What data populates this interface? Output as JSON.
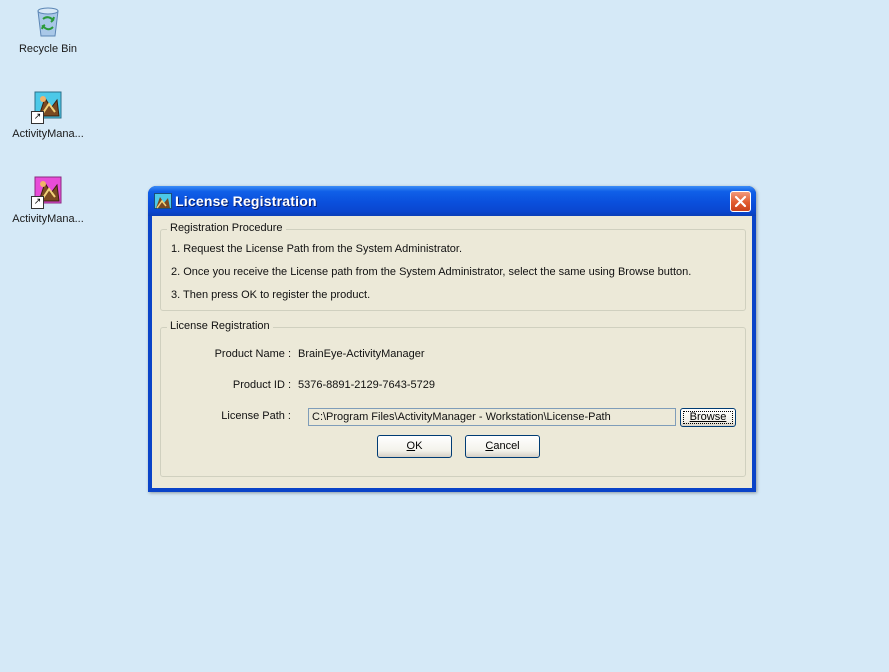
{
  "desktop": {
    "icons": [
      {
        "label": "Recycle Bin",
        "icon": "recycle-bin-icon"
      },
      {
        "label": "ActivityMana...",
        "icon": "activity-manager-shortcut-icon"
      },
      {
        "label": "ActivityMana...",
        "icon": "activity-manager-shortcut-icon"
      }
    ]
  },
  "dialog": {
    "title": "License Registration",
    "procedure": {
      "legend": "Registration Procedure",
      "steps": [
        "1. Request the License Path from the System Administrator.",
        "2. Once you receive the License path from the System Administrator, select the same using Browse button.",
        "3. Then press OK to register the product."
      ]
    },
    "registration": {
      "legend": "License Registration",
      "product_name_label": "Product Name :",
      "product_name": "BrainEye-ActivityManager",
      "product_id_label": "Product ID :",
      "product_id": "5376-8891-2129-7643-5729",
      "license_path_label": "License Path :",
      "license_path": "C:\\Program Files\\ActivityManager - Workstation\\License-Path"
    },
    "buttons": {
      "browse": "Browse",
      "ok_mnemonic": "O",
      "ok_rest": "K",
      "cancel_mnemonic": "C",
      "cancel_rest": "ancel"
    }
  }
}
